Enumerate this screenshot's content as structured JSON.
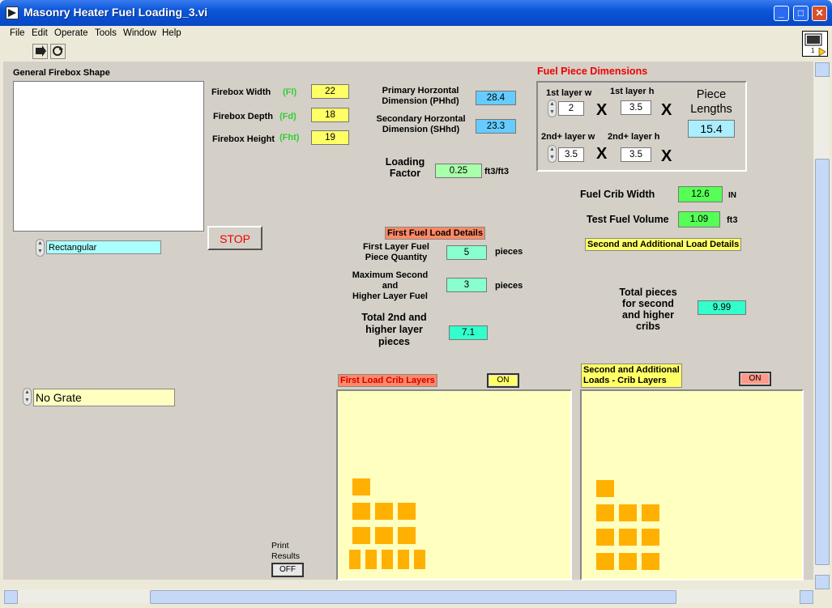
{
  "window": {
    "title": "Masonry Heater Fuel Loading_3.vi"
  },
  "menu": [
    "File",
    "Edit",
    "Operate",
    "Tools",
    "Window",
    "Help"
  ],
  "vi_icon_label": "1",
  "firebox_shape": {
    "label": "General Firebox Shape",
    "selected": "Rectangular"
  },
  "firebox": {
    "width_label": "Firebox Width",
    "width_sym": "(Fl)",
    "width": "22",
    "depth_label": "Firebox Depth",
    "depth_sym": "(Fd)",
    "depth": "18",
    "height_label": "Firebox Height",
    "height_sym": "(Fht)",
    "height": "19"
  },
  "dims": {
    "primary_label_1": "Primary Horzontal",
    "primary_label_2": "Dimension (PHhd)",
    "primary": "28.4",
    "secondary_label_1": "Secondary Horzontal",
    "secondary_label_2": "Dimension (SHhd)",
    "secondary": "23.3"
  },
  "loading": {
    "label_1": "Loading",
    "label_2": "Factor",
    "value": "0.25",
    "unit": "ft3/ft3"
  },
  "fuel_piece": {
    "title": "Fuel Piece Dimensions",
    "l1w_label": "1st layer w",
    "l1w": "2",
    "l1h_label": "1st layer h",
    "l1h": "3.5",
    "l2w_label": "2nd+ layer w",
    "l2w": "3.5",
    "l2h_label": "2nd+ layer h",
    "l2h": "3.5",
    "x": "X",
    "piece_label_1": "Piece",
    "piece_label_2": "Lengths",
    "piece_length": "15.4"
  },
  "crib": {
    "width_label": "Fuel Crib Width",
    "width": "12.6",
    "width_unit": "IN",
    "volume_label": "Test Fuel Volume",
    "volume": "1.09",
    "volume_unit": "ft3"
  },
  "stop_label": "STOP",
  "first_load": {
    "title": "First Fuel Load Details",
    "first_qty_label_1": "First Layer Fuel",
    "first_qty_label_2": "Piece Quantity",
    "first_qty": "5",
    "pieces": "pieces",
    "max_label_1": "Maximum Second",
    "max_label_2": "and",
    "max_label_3": "Higher  Layer Fuel",
    "max_qty": "3",
    "total_label_1": "Total  2nd and",
    "total_label_2": "higher layer",
    "total_label_3": "pieces",
    "total": "7.1"
  },
  "second_load": {
    "title": "Second and Additional Load Details",
    "total_label_1": "Total pieces",
    "total_label_2": "for second",
    "total_label_3": "and higher",
    "total_label_4": "cribs",
    "total": "9.99"
  },
  "grate": {
    "selected": "No Grate"
  },
  "graph1": {
    "title": "First Load Crib Layers",
    "toggle": "ON"
  },
  "graph2": {
    "title_1": "Second and Additional",
    "title_2": "Loads -  Crib Layers",
    "toggle": "ON"
  },
  "print": {
    "label_1": "Print",
    "label_2": "Results",
    "toggle": "OFF"
  },
  "colors": {
    "block": "#ffb000",
    "graph_bg": "#ffffc0",
    "panel": "#d4d0c8"
  }
}
